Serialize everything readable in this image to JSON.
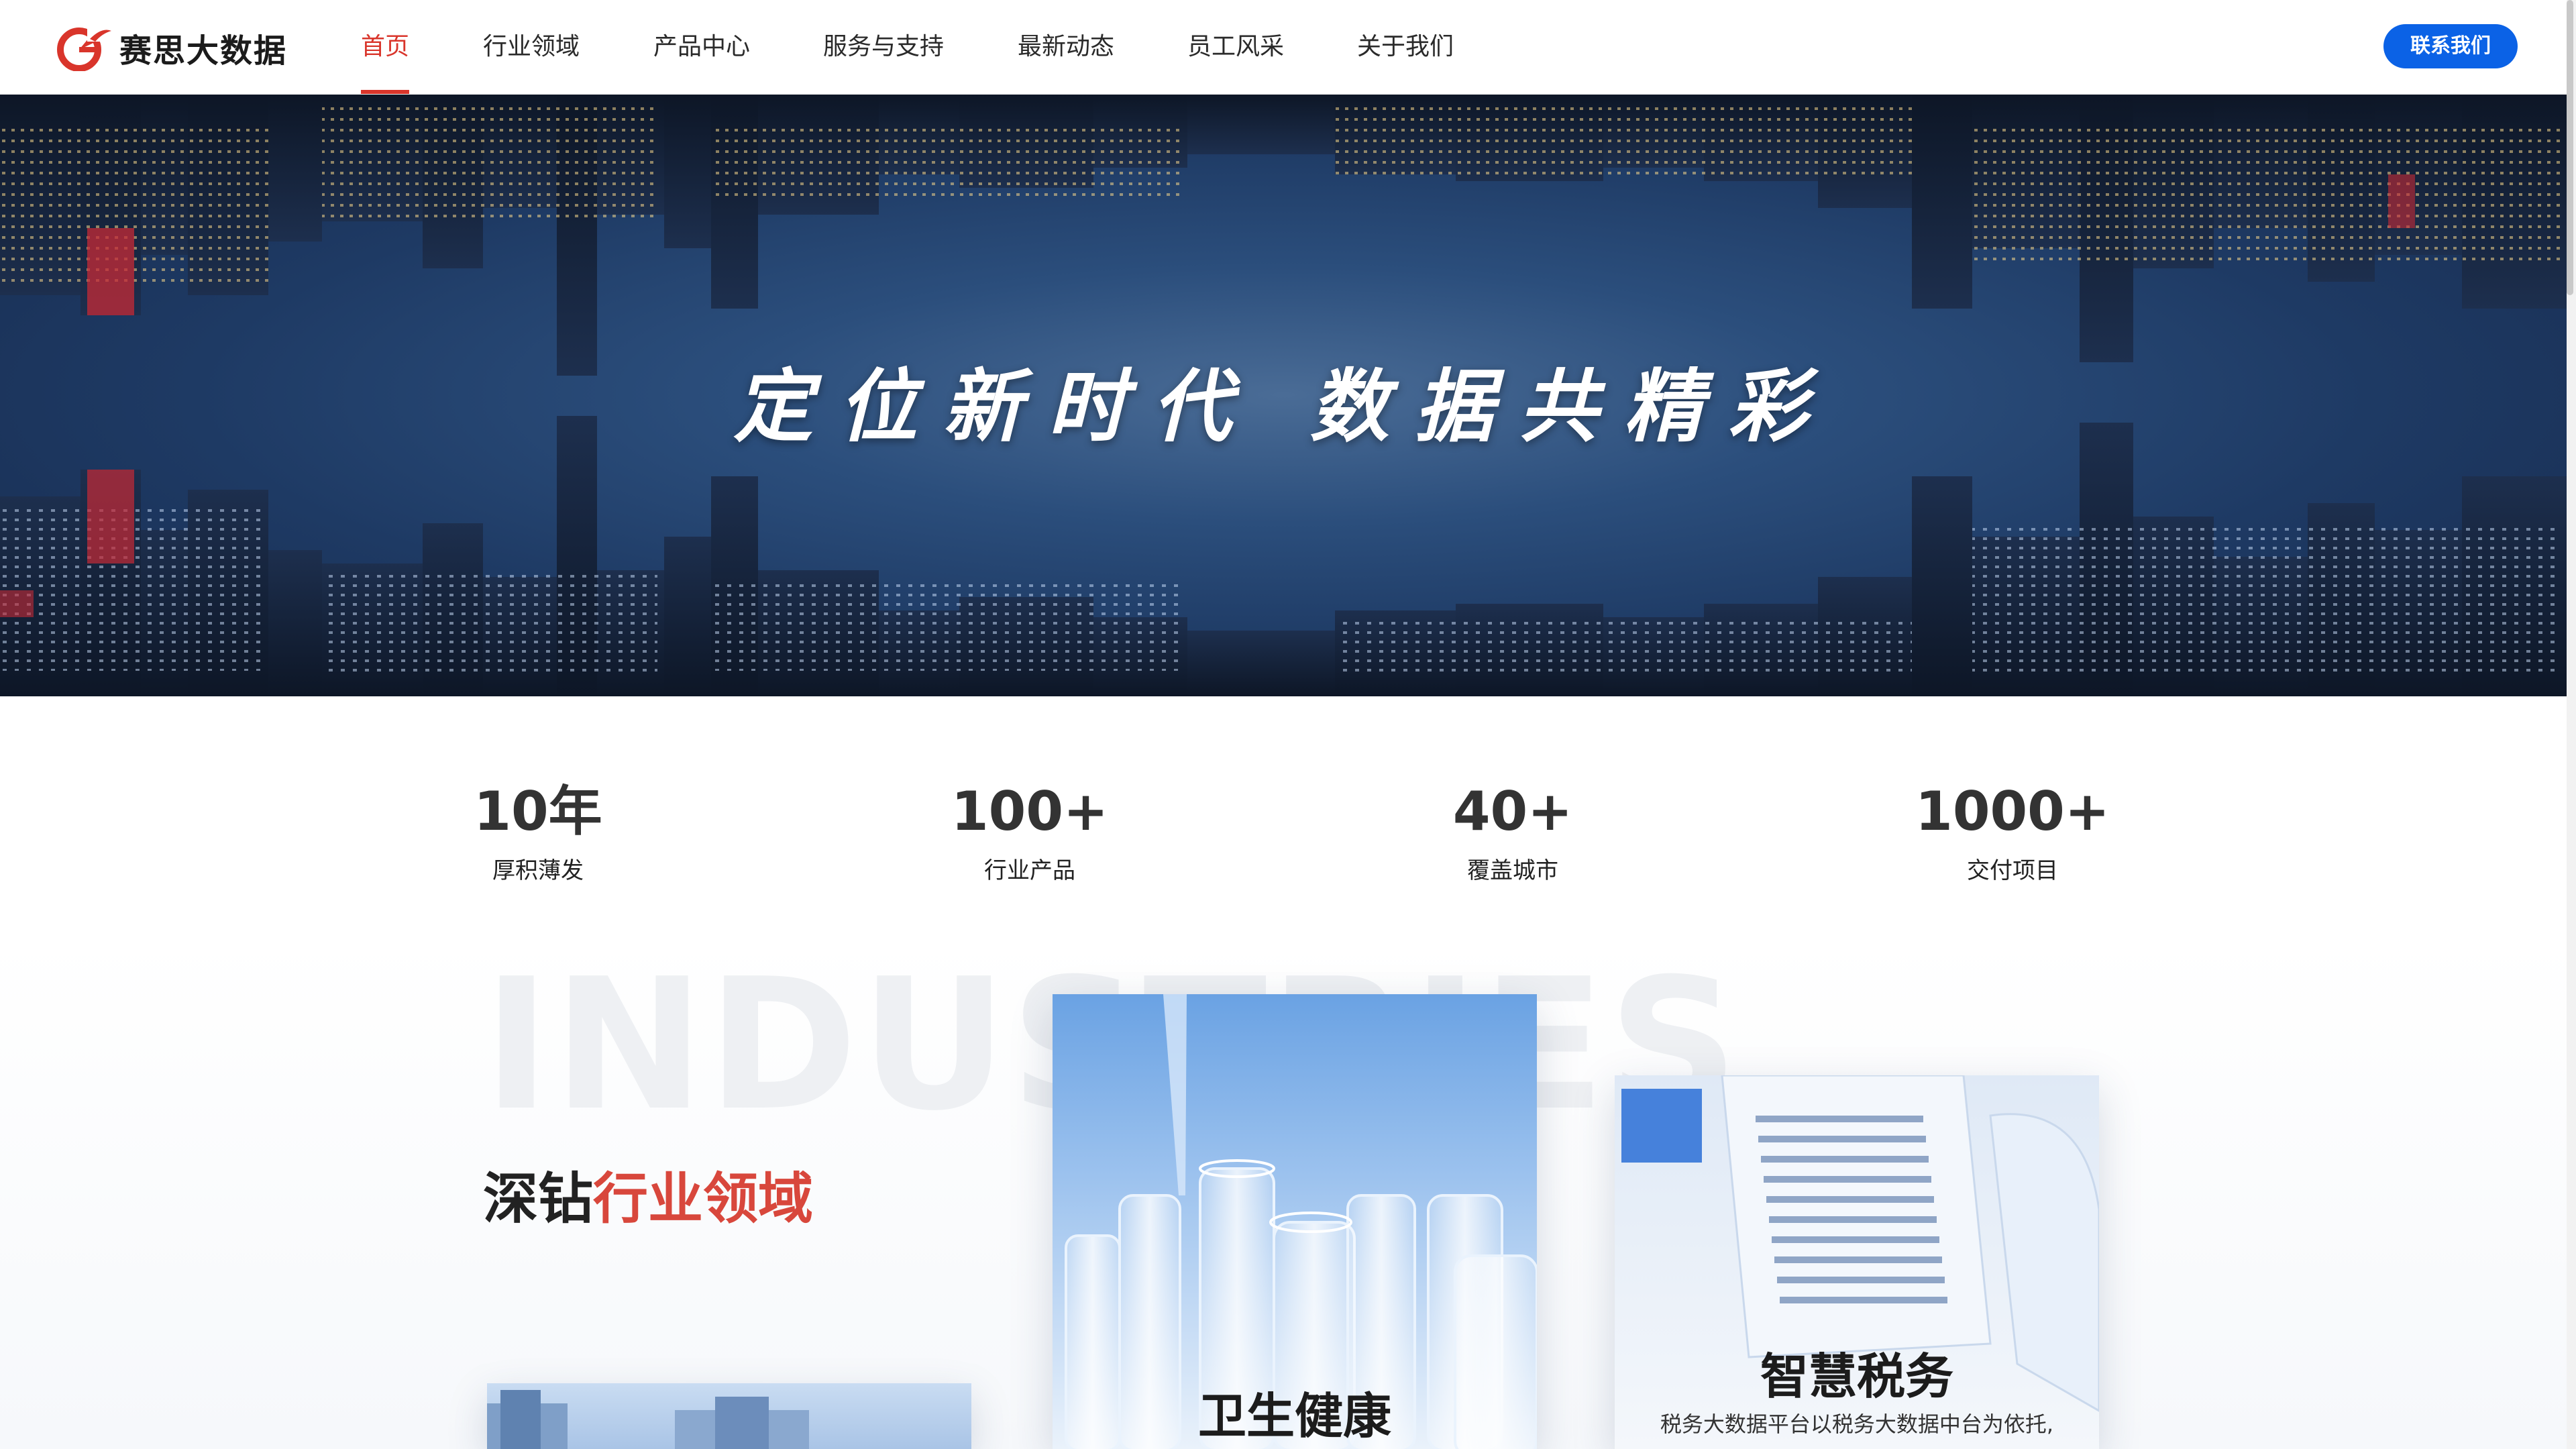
{
  "header": {
    "logo_text": "赛思大数据",
    "nav": [
      "首页",
      "行业领域",
      "产品中心",
      "服务与支持",
      "最新动态",
      "员工风采",
      "关于我们"
    ],
    "active_index": 0,
    "contact_label": "联系我们"
  },
  "hero": {
    "title": "定位新时代 数据共精彩"
  },
  "stats": [
    {
      "value": "10年",
      "label": "厚积薄发"
    },
    {
      "value": "100+",
      "label": "行业产品"
    },
    {
      "value": "40+",
      "label": "覆盖城市"
    },
    {
      "value": "1000+",
      "label": "交付项目"
    }
  ],
  "industries": {
    "watermark": "INDUSTRIES",
    "title_plain": "深钻",
    "title_accent": "行业领域",
    "cards": [
      {
        "title": "卫生健康"
      },
      {
        "title": "智慧税务",
        "desc": "税务大数据平台以税务大数据中台为依托,"
      }
    ]
  },
  "colors": {
    "accent_red": "#d9352b",
    "button_blue": "#0b62e6"
  },
  "icons": {
    "logo": "swirl-logo-icon"
  }
}
